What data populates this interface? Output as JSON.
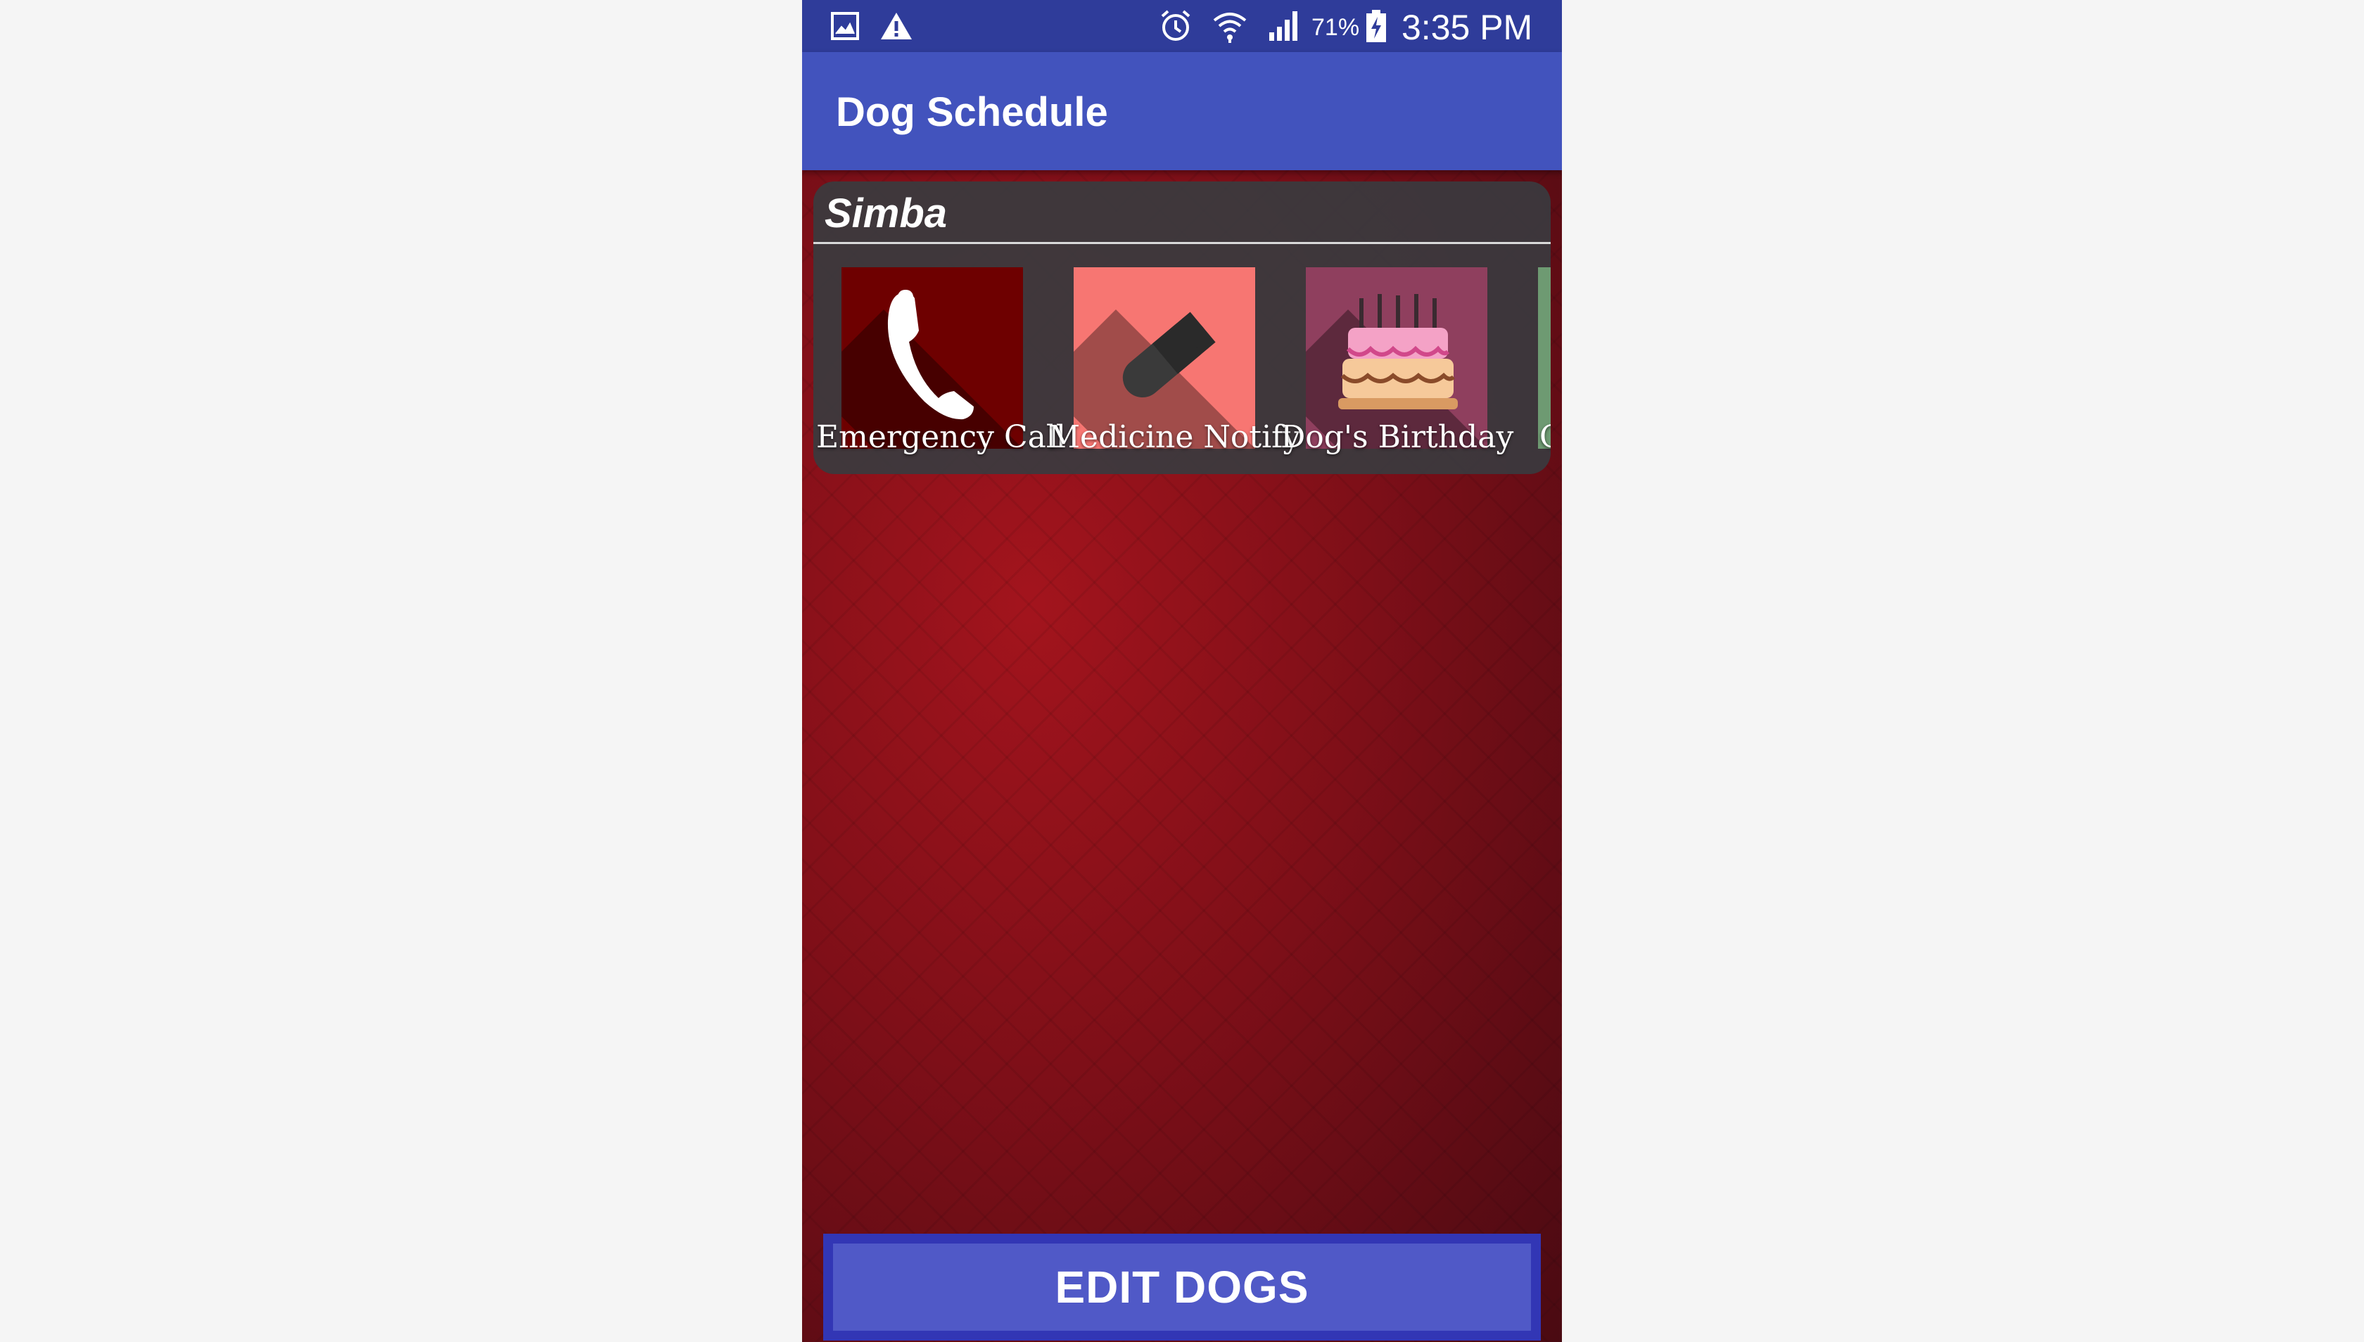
{
  "status_bar": {
    "battery": "71%",
    "time": "3:35 PM",
    "icons": [
      "gallery-icon",
      "warning-icon",
      "alarm-icon",
      "wifi-icon",
      "signal-icon",
      "battery-charging-icon"
    ]
  },
  "app_bar": {
    "title": "Dog Schedule"
  },
  "dog_card": {
    "name": "Simba",
    "items": [
      {
        "label": "Emergency Call",
        "icon": "phone-icon",
        "color": "#6e0000"
      },
      {
        "label": "Medicine Notify",
        "icon": "pill-icon",
        "color": "#f77672"
      },
      {
        "label": "Dog's Birthday",
        "icon": "cake-icon",
        "color": "#8f3f5e"
      },
      {
        "label": "C",
        "icon": "",
        "color": "#6e9a72"
      }
    ]
  },
  "footer": {
    "edit_button_label": "EDIT DOGS"
  },
  "colors": {
    "status_bar": "#2f3c9a",
    "app_bar": "#4253bd",
    "background": "#7e0f18",
    "button": "#5059c7",
    "button_border": "#3236b5"
  }
}
